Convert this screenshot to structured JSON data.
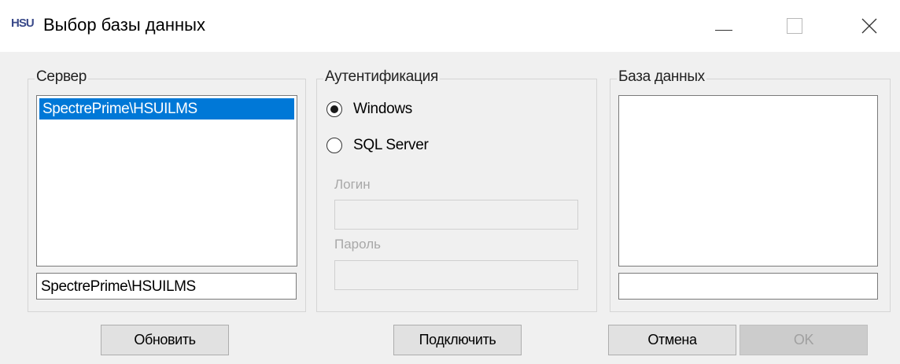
{
  "window": {
    "icon_text": "HSU",
    "title": "Выбор базы данных"
  },
  "server": {
    "label": "Сервер",
    "items": [
      "SpectrePrime\\HSUILMS"
    ],
    "selected_index": 0,
    "input_value": "SpectrePrime\\HSUILMS"
  },
  "auth": {
    "label": "Аутентификация",
    "options": [
      {
        "label": "Windows",
        "checked": true
      },
      {
        "label": "SQL Server",
        "checked": false
      }
    ],
    "login_label": "Логин",
    "login_value": "",
    "password_label": "Пароль",
    "password_value": ""
  },
  "database": {
    "label": "База данных",
    "items": [],
    "input_value": ""
  },
  "buttons": {
    "refresh": "Обновить",
    "connect": "Подключить",
    "cancel": "Отмена",
    "ok": "OK"
  },
  "colors": {
    "selection": "#0078d7",
    "window_bg": "#f0f0f0",
    "disabled_text": "#a8a8a8"
  },
  "icons": [
    "minimize-icon",
    "maximize-icon",
    "close-icon"
  ]
}
